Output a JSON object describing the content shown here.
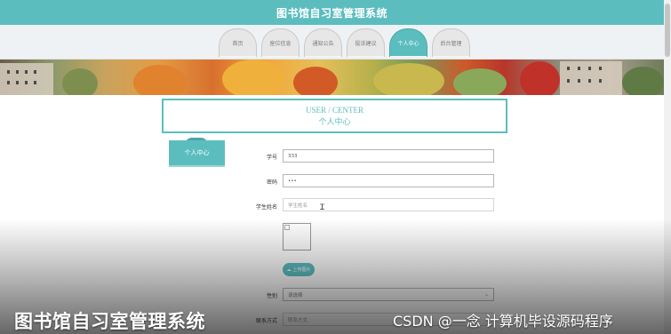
{
  "header": {
    "title": "图书馆自习室管理系统"
  },
  "nav": {
    "tabs": [
      {
        "label": "首页",
        "active": false
      },
      {
        "label": "座位信息",
        "active": false
      },
      {
        "label": "通知公告",
        "active": false
      },
      {
        "label": "投诉建议",
        "active": false
      },
      {
        "label": "个人中心",
        "active": true
      },
      {
        "label": "后台管理",
        "active": false
      }
    ]
  },
  "center": {
    "title_en": "USER / CENTER",
    "title_zh": "个人中心"
  },
  "sidebar": {
    "active_item": "个人中心"
  },
  "form": {
    "student_id": {
      "label": "学号",
      "value": "333"
    },
    "password": {
      "label": "密码",
      "value": "•••"
    },
    "student_name": {
      "label": "学生姓名",
      "placeholder": "学生姓名"
    },
    "upload_button": "上传图片",
    "gender": {
      "label": "性别",
      "placeholder": "请选择"
    },
    "contact": {
      "label": "联系方式",
      "placeholder": "联系方式"
    }
  },
  "watermark": {
    "left": "图书馆自习室管理系统",
    "right": "CSDN @一念 计算机毕设源码程序"
  },
  "colors": {
    "accent": "#5cbdbf",
    "nav_bg": "#eef2f5",
    "tab_inactive": "#e7e7e7"
  }
}
